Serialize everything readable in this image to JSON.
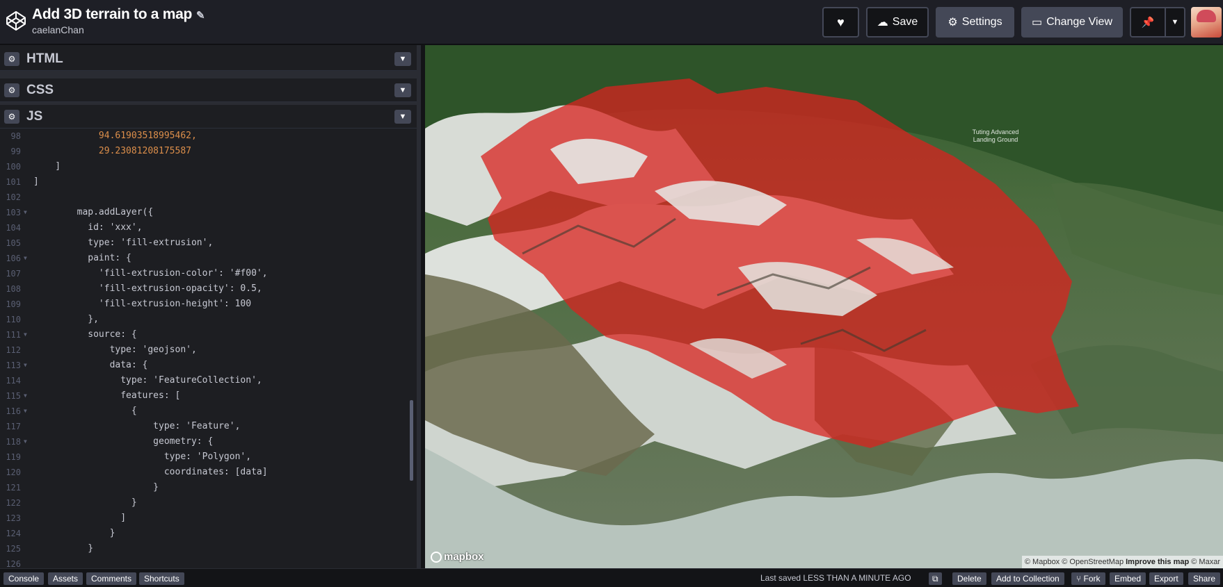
{
  "header": {
    "title": "Add 3D terrain to a map",
    "author": "caelanChan",
    "buttons": {
      "save": "Save",
      "settings": "Settings",
      "change_view": "Change View"
    }
  },
  "editors": {
    "html_label": "HTML",
    "css_label": "CSS",
    "js_label": "JS"
  },
  "code": [
    {
      "n": "98",
      "t": "            94.61903518995462,"
    },
    {
      "n": "99",
      "t": "            29.23081208175587"
    },
    {
      "n": "100",
      "t": "    ]"
    },
    {
      "n": "101",
      "t": "]"
    },
    {
      "n": "102",
      "t": ""
    },
    {
      "n": "103",
      "t": "        map.addLayer({"
    },
    {
      "n": "104",
      "t": "          id: 'xxx',"
    },
    {
      "n": "105",
      "t": "          type: 'fill-extrusion',"
    },
    {
      "n": "106",
      "t": "          paint: {"
    },
    {
      "n": "107",
      "t": "            'fill-extrusion-color': '#f00',"
    },
    {
      "n": "108",
      "t": "            'fill-extrusion-opacity': 0.5,"
    },
    {
      "n": "109",
      "t": "            'fill-extrusion-height': 100"
    },
    {
      "n": "110",
      "t": "          },"
    },
    {
      "n": "111",
      "t": "          source: {"
    },
    {
      "n": "112",
      "t": "              type: 'geojson',"
    },
    {
      "n": "113",
      "t": "              data: {"
    },
    {
      "n": "114",
      "t": "                type: 'FeatureCollection',"
    },
    {
      "n": "115",
      "t": "                features: ["
    },
    {
      "n": "116",
      "t": "                  {"
    },
    {
      "n": "117",
      "t": "                      type: 'Feature',"
    },
    {
      "n": "118",
      "t": "                      geometry: {"
    },
    {
      "n": "119",
      "t": "                        type: 'Polygon',"
    },
    {
      "n": "120",
      "t": "                        coordinates: [data]"
    },
    {
      "n": "121",
      "t": "                      }"
    },
    {
      "n": "122",
      "t": "                  }"
    },
    {
      "n": "123",
      "t": "                ]"
    },
    {
      "n": "124",
      "t": "              }"
    },
    {
      "n": "125",
      "t": "          }"
    },
    {
      "n": "126",
      "t": ""
    }
  ],
  "map": {
    "logo": "mapbox",
    "attribution_1": "© Mapbox © OpenStreetMap",
    "attribution_2": "Improve this map",
    "attribution_3": "© Maxar",
    "place_label": "Tuting Advanced Landing Ground"
  },
  "footer": {
    "console": "Console",
    "assets": "Assets",
    "comments": "Comments",
    "shortcuts": "Shortcuts",
    "last_saved": "Last saved LESS THAN A MINUTE AGO",
    "delete": "Delete",
    "add_to_collection": "Add to Collection",
    "fork": "Fork",
    "embed": "Embed",
    "export": "Export",
    "share": "Share"
  },
  "colors": {
    "accent_fill_extrusion": "#ff0000",
    "header_bg": "#1e1f26",
    "button_bg": "#444857"
  }
}
